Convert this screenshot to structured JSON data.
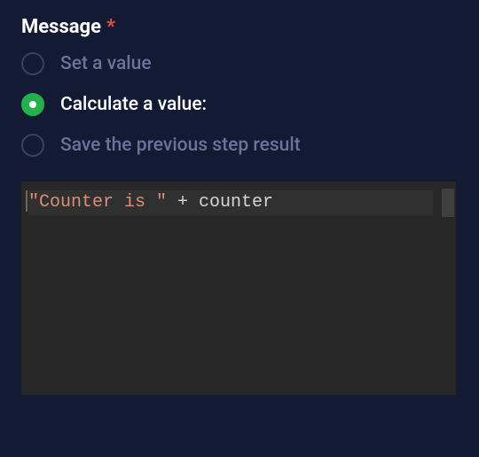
{
  "field": {
    "label": "Message",
    "required_marker": "*"
  },
  "radio_options": {
    "set_value": {
      "label": "Set a value",
      "selected": false
    },
    "calculate_value": {
      "label": "Calculate a value:",
      "selected": true
    },
    "save_previous": {
      "label": "Save the previous step result",
      "selected": false
    }
  },
  "code": {
    "string_part": "\"Counter is \"",
    "operator_part": " + ",
    "identifier_part": "counter"
  }
}
